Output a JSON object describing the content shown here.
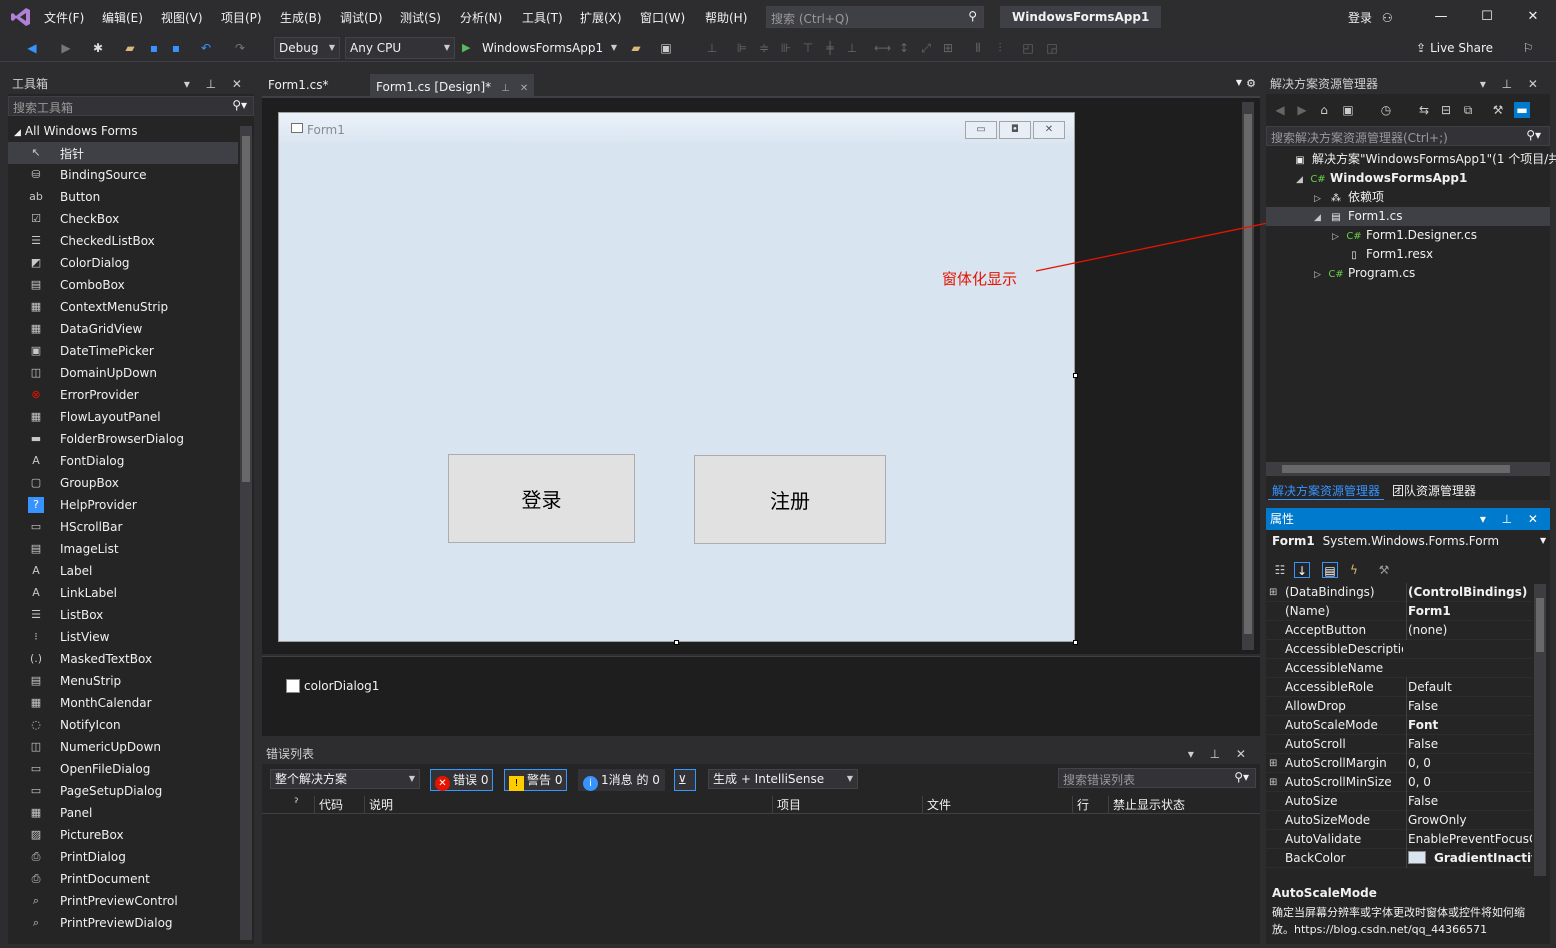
{
  "menu": [
    "文件(F)",
    "编辑(E)",
    "视图(V)",
    "项目(P)",
    "生成(B)",
    "调试(D)",
    "测试(S)",
    "分析(N)",
    "工具(T)",
    "扩展(X)",
    "窗口(W)",
    "帮助(H)"
  ],
  "search": {
    "placeholder": "搜索 (Ctrl+Q)"
  },
  "app_title": "WindowsFormsApp1",
  "account": {
    "login_label": "登录"
  },
  "window_buttons": {
    "minimize": "—",
    "maximize": "☐",
    "close": "✕"
  },
  "toolbar": {
    "config": "Debug",
    "platform": "Any CPU",
    "run_target": "WindowsFormsApp1",
    "live_share": "Live Share"
  },
  "toolbox": {
    "title": "工具箱",
    "search_placeholder": "搜索工具箱",
    "group": "All Windows Forms",
    "items": [
      {
        "label": "指针",
        "icon": "pointer-icon",
        "glyph": "↖"
      },
      {
        "label": "BindingSource",
        "icon": "bindingsource-icon",
        "glyph": "⛁"
      },
      {
        "label": "Button",
        "icon": "button-icon",
        "glyph": "ab"
      },
      {
        "label": "CheckBox",
        "icon": "checkbox-icon",
        "glyph": "☑"
      },
      {
        "label": "CheckedListBox",
        "icon": "checkedlistbox-icon",
        "glyph": "☰"
      },
      {
        "label": "ColorDialog",
        "icon": "colordialog-icon",
        "glyph": "◩"
      },
      {
        "label": "ComboBox",
        "icon": "combobox-icon",
        "glyph": "▤"
      },
      {
        "label": "ContextMenuStrip",
        "icon": "contextmenu-icon",
        "glyph": "▦"
      },
      {
        "label": "DataGridView",
        "icon": "datagrid-icon",
        "glyph": "▦"
      },
      {
        "label": "DateTimePicker",
        "icon": "datetime-icon",
        "glyph": "▣"
      },
      {
        "label": "DomainUpDown",
        "icon": "domainupdown-icon",
        "glyph": "◫"
      },
      {
        "label": "ErrorProvider",
        "icon": "errorprovider-icon",
        "glyph": "⊗"
      },
      {
        "label": "FlowLayoutPanel",
        "icon": "flowlayout-icon",
        "glyph": "▦"
      },
      {
        "label": "FolderBrowserDialog",
        "icon": "folder-icon",
        "glyph": "▬"
      },
      {
        "label": "FontDialog",
        "icon": "fontdialog-icon",
        "glyph": "A"
      },
      {
        "label": "GroupBox",
        "icon": "groupbox-icon",
        "glyph": "▢"
      },
      {
        "label": "HelpProvider",
        "icon": "help-icon",
        "glyph": "?"
      },
      {
        "label": "HScrollBar",
        "icon": "hscroll-icon",
        "glyph": "▭"
      },
      {
        "label": "ImageList",
        "icon": "imagelist-icon",
        "glyph": "▤"
      },
      {
        "label": "Label",
        "icon": "label-icon",
        "glyph": "A"
      },
      {
        "label": "LinkLabel",
        "icon": "linklabel-icon",
        "glyph": "A"
      },
      {
        "label": "ListBox",
        "icon": "listbox-icon",
        "glyph": "☰"
      },
      {
        "label": "ListView",
        "icon": "listview-icon",
        "glyph": "⁝"
      },
      {
        "label": "MaskedTextBox",
        "icon": "maskedtext-icon",
        "glyph": "(.)"
      },
      {
        "label": "MenuStrip",
        "icon": "menustrip-icon",
        "glyph": "▤"
      },
      {
        "label": "MonthCalendar",
        "icon": "calendar-icon",
        "glyph": "▦"
      },
      {
        "label": "NotifyIcon",
        "icon": "notify-icon",
        "glyph": "◌"
      },
      {
        "label": "NumericUpDown",
        "icon": "numericupdown-icon",
        "glyph": "◫"
      },
      {
        "label": "OpenFileDialog",
        "icon": "openfile-icon",
        "glyph": "▭"
      },
      {
        "label": "PageSetupDialog",
        "icon": "pagesetup-icon",
        "glyph": "▭"
      },
      {
        "label": "Panel",
        "icon": "panel-icon",
        "glyph": "▦"
      },
      {
        "label": "PictureBox",
        "icon": "picturebox-icon",
        "glyph": "▨"
      },
      {
        "label": "PrintDialog",
        "icon": "printdialog-icon",
        "glyph": "⎙"
      },
      {
        "label": "PrintDocument",
        "icon": "printdocument-icon",
        "glyph": "⎙"
      },
      {
        "label": "PrintPreviewControl",
        "icon": "printpreview-icon",
        "glyph": "⌕"
      },
      {
        "label": "PrintPreviewDialog",
        "icon": "printpreviewdialog-icon",
        "glyph": "⌕"
      }
    ]
  },
  "tabs": [
    {
      "label": "Form1.cs*"
    },
    {
      "label": "Form1.cs [Design]*"
    }
  ],
  "form": {
    "title": "Form1",
    "buttons": [
      {
        "label": "登录"
      },
      {
        "label": "注册"
      }
    ]
  },
  "annotation": "窗体化显示",
  "tray": {
    "component": "colorDialog1"
  },
  "error_list": {
    "title": "错误列表",
    "scope": "整个解决方案",
    "errors": "错误 0",
    "warnings": "警告 0",
    "messages": "1消息 的 0",
    "build_filter": "生成 + IntelliSense",
    "search_placeholder": "搜索错误列表",
    "columns": [
      "代码",
      "说明",
      "项目",
      "文件",
      "行",
      "禁止显示状态"
    ]
  },
  "solution_explorer": {
    "title": "解决方案资源管理器",
    "search_placeholder": "搜索解决方案资源管理器(Ctrl+;)",
    "tree": [
      {
        "label": "解决方案\"WindowsFormsApp1\"(1 个项目/共",
        "depth": 0,
        "exp": "",
        "glyph": "▣"
      },
      {
        "label": "WindowsFormsApp1",
        "depth": 1,
        "exp": "◢",
        "glyph": "C#"
      },
      {
        "label": "依赖项",
        "depth": 2,
        "exp": "▷",
        "glyph": "⁂"
      },
      {
        "label": "Form1.cs",
        "depth": 2,
        "exp": "◢",
        "glyph": "▤"
      },
      {
        "label": "Form1.Designer.cs",
        "depth": 3,
        "exp": "▷",
        "glyph": "C#"
      },
      {
        "label": "Form1.resx",
        "depth": 3,
        "exp": "",
        "glyph": "▯"
      },
      {
        "label": "Program.cs",
        "depth": 2,
        "exp": "▷",
        "glyph": "C#"
      }
    ],
    "bottom_tabs": [
      "解决方案资源管理器",
      "团队资源管理器"
    ]
  },
  "properties": {
    "title": "属性",
    "object_name": "Form1",
    "object_type": "System.Windows.Forms.Form",
    "rows": [
      {
        "name": "(DataBindings)",
        "value": "(ControlBindings)",
        "bold": true,
        "expand": "⊞"
      },
      {
        "name": "(Name)",
        "value": "Form1",
        "bold": true,
        "expand": ""
      },
      {
        "name": "AcceptButton",
        "value": "(none)",
        "bold": false,
        "expand": ""
      },
      {
        "name": "AccessibleDescriptio",
        "value": "",
        "bold": false,
        "expand": ""
      },
      {
        "name": "AccessibleName",
        "value": "",
        "bold": false,
        "expand": ""
      },
      {
        "name": "AccessibleRole",
        "value": "Default",
        "bold": false,
        "expand": ""
      },
      {
        "name": "AllowDrop",
        "value": "False",
        "bold": false,
        "expand": ""
      },
      {
        "name": "AutoScaleMode",
        "value": "Font",
        "bold": true,
        "expand": ""
      },
      {
        "name": "AutoScroll",
        "value": "False",
        "bold": false,
        "expand": ""
      },
      {
        "name": "AutoScrollMargin",
        "value": "0, 0",
        "bold": false,
        "expand": "⊞"
      },
      {
        "name": "AutoScrollMinSize",
        "value": "0, 0",
        "bold": false,
        "expand": "⊞"
      },
      {
        "name": "AutoSize",
        "value": "False",
        "bold": false,
        "expand": ""
      },
      {
        "name": "AutoSizeMode",
        "value": "GrowOnly",
        "bold": false,
        "expand": ""
      },
      {
        "name": "AutoValidate",
        "value": "EnablePreventFocusC",
        "bold": false,
        "expand": ""
      },
      {
        "name": "BackColor",
        "value": "GradientInactive",
        "bold": true,
        "expand": "",
        "swatch": true
      }
    ],
    "desc_title": "AutoScaleMode",
    "desc_text": "确定当屏幕分辨率或字体更改时窗体或控件将如何缩放。https://blog.csdn.net/qq_44366571"
  },
  "colors": {
    "bg": "#2d2d30",
    "panel": "#252526",
    "editor": "#1e1e1e",
    "accent": "#007acc",
    "form_client": "#d8e4f0",
    "annotation": "#e51400"
  }
}
